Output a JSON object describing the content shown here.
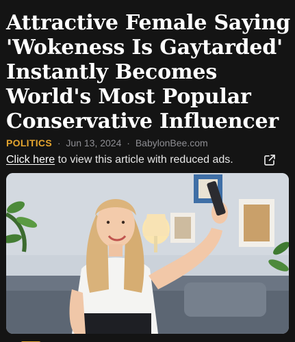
{
  "article": {
    "headline": "Attractive Female Saying\n'Wokeness Is Gaytarded'\nInstantly Becomes\nWorld's Most Popular\nConservative Influencer",
    "category": "POLITICS",
    "date": "Jun 13, 2024",
    "source": "BabylonBee.com",
    "separator": "·"
  },
  "reduced_ads": {
    "link_text": "Click here",
    "rest_text": " to view this article with reduced ads.",
    "icon": "external-link-icon"
  },
  "hero_image": {
    "subject": "smiling blonde woman taking a selfie on a couch",
    "icon": "photo"
  },
  "colors": {
    "background": "#141414",
    "category": "#e5a52e",
    "meta": "#8e8e93",
    "text": "#ffffff"
  }
}
